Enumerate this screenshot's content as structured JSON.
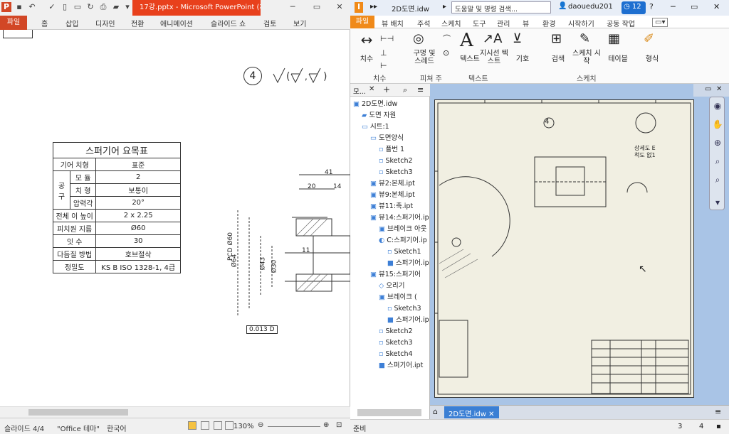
{
  "ppt": {
    "window_title": "17강.pptx - Microsoft PowerPoint (체...",
    "tabs": [
      "파일",
      "홈",
      "삽입",
      "디자인",
      "전환",
      "애니메이션",
      "슬라이드 쇼",
      "검토",
      "보기"
    ],
    "slide": {
      "circled_number": "4",
      "table_title": "스퍼기어 요목표",
      "rows": [
        [
          "기어 치형",
          "표준"
        ],
        [
          "모 듈",
          "2"
        ],
        [
          "치 형",
          "보통이"
        ],
        [
          "압력각",
          "20°"
        ],
        [
          "전체 이 높이",
          "2 x 2.25"
        ],
        [
          "피치원 지름",
          "Ø60"
        ],
        [
          "잇 수",
          "30"
        ],
        [
          "다듬질 방법",
          "호브절삭"
        ],
        [
          "정밀도",
          "KS B ISO 1328-1, 4급"
        ]
      ],
      "tool_group_label": "공 구",
      "dim_41": "41",
      "dim_20": "20",
      "dim_14": "14",
      "dim_11": "11",
      "dim_64": "Ø64",
      "dim_pcd": "PCD Ø60",
      "dim_43": "Ø43",
      "dim_30": "Ø30",
      "tolerance": "0.013 D"
    },
    "status": {
      "slide_info": "슬라이드 4/4",
      "theme": "\"Office 테마\"",
      "language": "한국어",
      "zoom": "130%"
    }
  },
  "inventor": {
    "doc_title": "2D도면.idw",
    "search_placeholder": "도움말 및 명령 검색...",
    "user": "daouedu201",
    "badge_count": "12",
    "tabs": [
      "파일",
      "뷰 배치",
      "주석",
      "스케치",
      "도구",
      "관리",
      "뷰",
      "환경",
      "시작하기",
      "공동 작업"
    ],
    "ribbon": {
      "dim_label": "치수",
      "hole_label": "구멍 및 스레드",
      "text_label": "텍스트",
      "leader_label": "지시선 텍스트",
      "symbol_label": "기호",
      "search_label": "검색",
      "sketch_start_label": "스케치 시작",
      "table_label": "테이블",
      "format_label": "형식",
      "group_dim": "치수",
      "group_feature": "피쳐 주",
      "group_text": "텍스트",
      "group_sketch": "스케치"
    },
    "browser": {
      "title": "모...",
      "items": [
        "2D도면.idw",
        "도면 자원",
        "시트:1",
        "도면양식",
        "플번 1",
        "Sketch2",
        "Sketch3",
        "뷰2:본체.ipt",
        "뷰9:본체.ipt",
        "뷰11:축.ipt",
        "뷰14:스퍼기어.ip",
        "브레이크 아웃",
        "C:스퍼기어.ip",
        "Sketch1",
        "스퍼기어.ip",
        "뷰15:스퍼기어",
        "오리기",
        "브레이크 (",
        "Sketch3",
        "스퍼기어.ip",
        "Sketch2",
        "Sketch3",
        "Sketch4",
        "스퍼기어.ipt"
      ]
    },
    "canvas": {
      "detail_label": "상세도 E",
      "detail_scale": "척도 없1"
    },
    "doc_tab": "2D도면.idw",
    "status": {
      "ready": "준비",
      "num1": "3",
      "num2": "4"
    }
  }
}
